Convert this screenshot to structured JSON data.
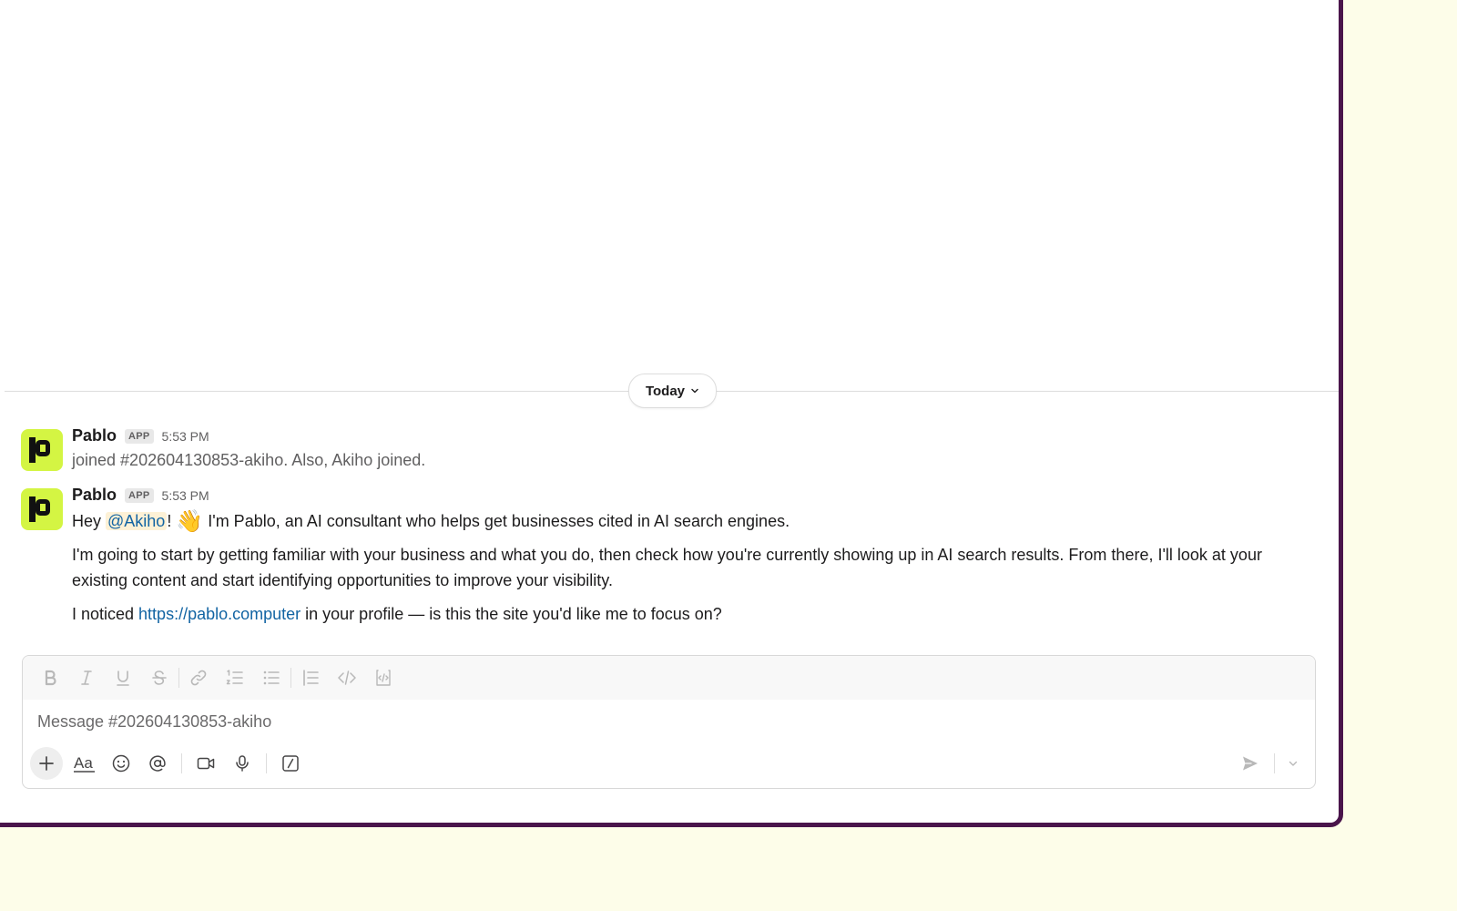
{
  "theme": {
    "accent": "#4a154b",
    "link": "#1264a3",
    "avatar_bg": "#d4f543",
    "page_bg": "#fdfde9"
  },
  "date_divider": {
    "label": "Today",
    "icon": "chevron-down-icon"
  },
  "messages": [
    {
      "sender": "Pablo",
      "badge": "APP",
      "time": "5:53 PM",
      "system_text": "joined #202604130853-akiho. Also, Akiho joined."
    },
    {
      "sender": "Pablo",
      "badge": "APP",
      "time": "5:53 PM",
      "line1_prefix": "Hey ",
      "mention": "@Akiho",
      "line1_bang": "!",
      "emoji": "👋",
      "line1_suffix": " I'm Pablo, an AI consultant who helps get businesses cited in AI search engines.",
      "para2": "I'm going to start by getting familiar with your business and what you do, then check how you're currently showing up in AI search results. From there, I'll look at your existing content and start identifying opportunities to improve your visibility.",
      "para3_prefix": "I noticed ",
      "para3_link": "https://pablo.computer",
      "para3_suffix": " in your profile — is this the site you'd like me to focus on?"
    }
  ],
  "composer": {
    "placeholder": "Message #202604130853-akiho",
    "format_icons": [
      "bold-icon",
      "italic-icon",
      "underline-icon",
      "strikethrough-icon",
      "link-icon",
      "ordered-list-icon",
      "bullet-list-icon",
      "blockquote-icon",
      "code-icon",
      "code-block-icon"
    ],
    "action_icons": [
      "plus-icon",
      "formatting-icon",
      "emoji-icon",
      "mention-icon",
      "video-icon",
      "microphone-icon",
      "slash-command-icon"
    ],
    "send_icon": "send-icon"
  }
}
